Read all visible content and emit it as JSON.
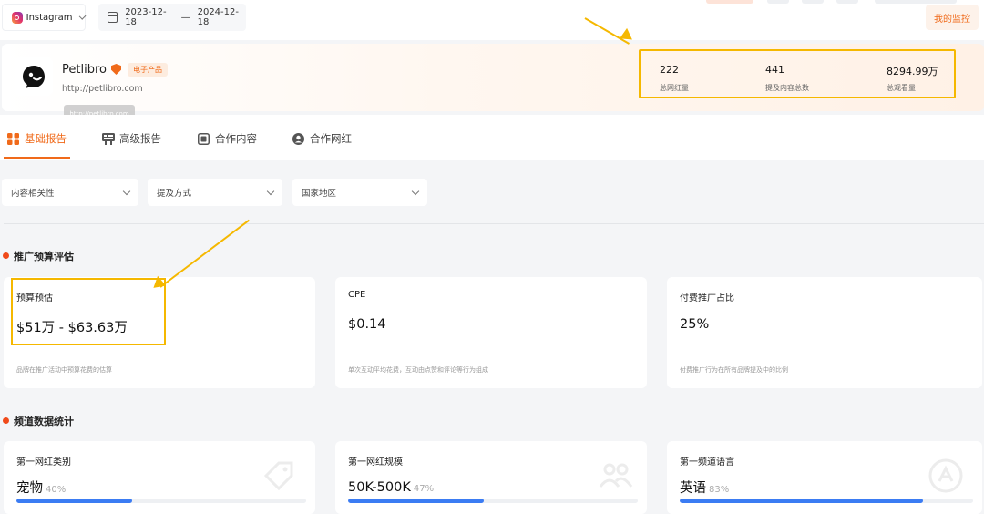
{
  "topbar": {
    "platform": "Instagram",
    "date_start": "2023-12-18",
    "date_sep": "—",
    "date_end": "2024-12-18",
    "monitor_label": "我的监控"
  },
  "brand": {
    "name": "Petlibro",
    "category": "电子产品",
    "url": "http://petlibro.com",
    "tooltip": "http://petlibro.com",
    "stats": [
      {
        "value": "222",
        "label": "总网红量"
      },
      {
        "value": "441",
        "label": "提及内容总数"
      },
      {
        "value": "8294.99万",
        "label": "总观看量"
      }
    ]
  },
  "tabs": [
    {
      "label": "基础报告",
      "icon": "grid-icon",
      "active": true
    },
    {
      "label": "高级报告",
      "icon": "report-icon",
      "active": false
    },
    {
      "label": "合作内容",
      "icon": "media-icon",
      "active": false
    },
    {
      "label": "合作网红",
      "icon": "user-icon",
      "active": false
    }
  ],
  "filters": [
    {
      "label": "内容相关性"
    },
    {
      "label": "提及方式"
    },
    {
      "label": "国家地区"
    }
  ],
  "budget_section": {
    "title": "推广预算评估",
    "cards": [
      {
        "label": "预算预估",
        "value": "$51万 - $63.63万",
        "desc": "品牌在推广活动中预算花费的估算"
      },
      {
        "label": "CPE",
        "value": "$0.14",
        "desc": "单次互动平均花费，互动由点赞和评论等行为组成"
      },
      {
        "label": "付费推广占比",
        "value": "25%",
        "desc": "付费推广行为在所有品牌提及中的比例"
      }
    ]
  },
  "channel_section": {
    "title": "频道数据统计",
    "cards": [
      {
        "label": "第一网红类别",
        "value": "宠物",
        "pct": "40%",
        "fill": 0.4
      },
      {
        "label": "第一网红规模",
        "value": "50K-500K",
        "pct": "47%",
        "fill": 0.47
      },
      {
        "label": "第一频道语言",
        "value": "英语",
        "pct": "83%",
        "fill": 0.83
      }
    ]
  },
  "colors": {
    "accent": "#f06a1a",
    "highlight": "#f5b800",
    "bar": "#3b7cf3"
  }
}
